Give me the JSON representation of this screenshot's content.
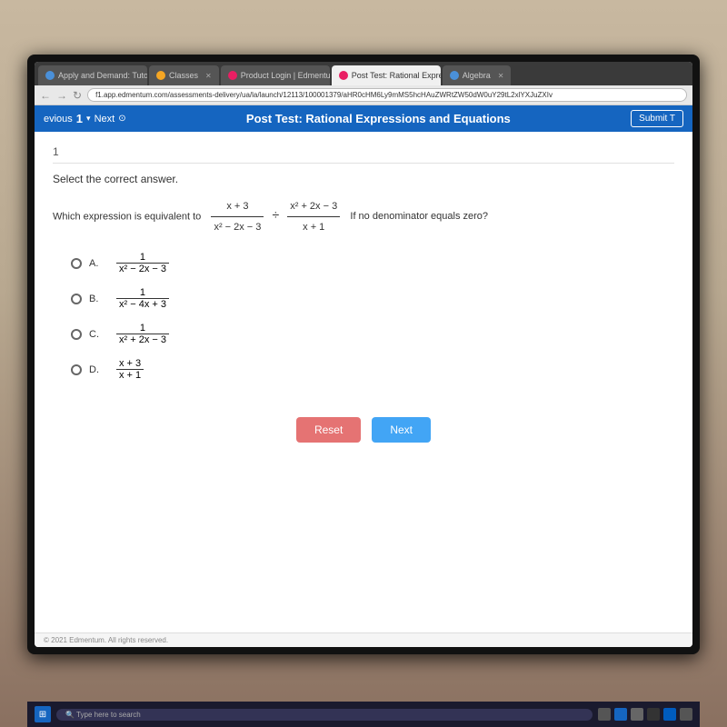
{
  "browser": {
    "tabs": [
      {
        "id": "tab1",
        "label": "Apply and Demand: Tutorial",
        "active": false,
        "icon": "blue"
      },
      {
        "id": "tab2",
        "label": "Classes",
        "active": false,
        "icon": "orange"
      },
      {
        "id": "tab3",
        "label": "Product Login | Edmentum",
        "active": false,
        "icon": "edmentum"
      },
      {
        "id": "tab4",
        "label": "Post Test: Rational Expressions",
        "active": true,
        "icon": "edmentum"
      },
      {
        "id": "tab5",
        "label": "Algebra",
        "active": false,
        "icon": "blue"
      }
    ],
    "address": "f1.app.edmentum.com/assessments-delivery/ua/la/launch/12113/100001379/aHR0cHM6Ly9mMS5hcHAuZWRtZW50dW0uY29tL2xlYXJuZXIv"
  },
  "toolbar": {
    "previous_label": "evious",
    "question_number": "1",
    "next_label": "Next",
    "title": "Post Test: Rational Expressions and Equations",
    "submit_label": "Submit T"
  },
  "question": {
    "number": "1",
    "instruction": "Select the correct answer.",
    "text": "Which expression is equivalent to",
    "expression_numerator1": "x + 3",
    "expression_denominator1": "x² − 2x − 3",
    "operator": "÷",
    "expression_numerator2": "x² + 2x − 3",
    "expression_denominator2": "x + 1",
    "condition": "If no denominator equals zero?",
    "options": [
      {
        "id": "A",
        "label": "A.",
        "answer_num": "1",
        "answer_den": "x² − 2x − 3"
      },
      {
        "id": "B",
        "label": "B.",
        "answer_num": "1",
        "answer_den": "x² − 4x + 3"
      },
      {
        "id": "C",
        "label": "C.",
        "answer_num": "1",
        "answer_den": "x² + 2x − 3"
      },
      {
        "id": "D",
        "label": "D.",
        "answer_num": "x + 3",
        "answer_den": "x + 1"
      }
    ]
  },
  "buttons": {
    "reset_label": "Reset",
    "next_label": "Next"
  },
  "footer": {
    "copyright": "© 2021 Edmentum. All rights reserved."
  },
  "taskbar": {
    "search_placeholder": "Type here to search"
  },
  "colors": {
    "toolbar_blue": "#1565c0",
    "reset_red": "#e57373",
    "next_blue": "#42a5f5"
  }
}
